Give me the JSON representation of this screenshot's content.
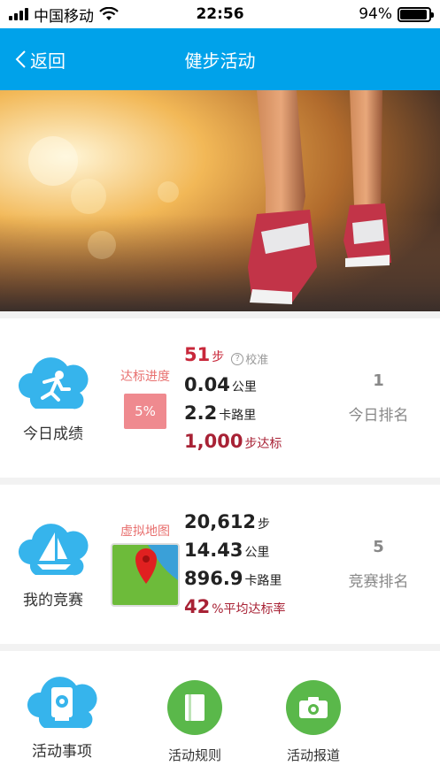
{
  "status_bar": {
    "carrier": "中国移动",
    "time": "22:56",
    "battery": "94%"
  },
  "nav": {
    "back_label": "返回",
    "title": "健步活动"
  },
  "today": {
    "label": "今日成绩",
    "progress_label": "达标进度",
    "progress_value": "5%",
    "steps": "51",
    "steps_unit": "步",
    "calibrate": "校准",
    "distance": "0.04",
    "distance_unit": "公里",
    "calories": "2.2",
    "calories_unit": "卡路里",
    "goal": "1,000",
    "goal_unit": "步达标",
    "rank": "1",
    "rank_label": "今日排名"
  },
  "race": {
    "label": "我的竞赛",
    "map_label": "虚拟地图",
    "steps": "20,612",
    "steps_unit": "步",
    "distance": "14.43",
    "distance_unit": "公里",
    "calories": "896.9",
    "calories_unit": "卡路里",
    "rate": "42",
    "rate_unit": "%平均达标率",
    "rank": "5",
    "rank_label": "竞赛排名"
  },
  "bottom": {
    "items": [
      {
        "label": "活动事项"
      },
      {
        "label": "活动规则"
      },
      {
        "label": "活动报道"
      }
    ]
  },
  "colors": {
    "accent": "#00a2ea",
    "green": "#5ab84a",
    "red": "#c8273a"
  }
}
